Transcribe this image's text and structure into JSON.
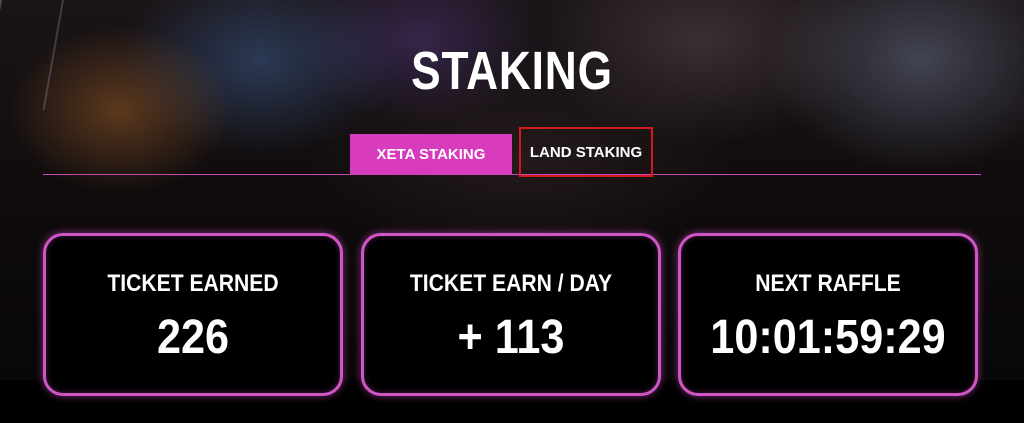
{
  "page": {
    "title": "STAKING"
  },
  "tabs": [
    {
      "label": "XETA STAKING",
      "active": true
    },
    {
      "label": "LAND STAKING",
      "active": false
    }
  ],
  "stats": [
    {
      "label": "TICKET EARNED",
      "value": "226"
    },
    {
      "label": "TICKET EARN / DAY",
      "value": "+ 113"
    },
    {
      "label": "NEXT RAFFLE",
      "value": "10:01:59:29"
    }
  ],
  "colors": {
    "accent": "#d83bbb",
    "card_border": "#cf57c5",
    "highlight_outline": "#d5181e"
  }
}
